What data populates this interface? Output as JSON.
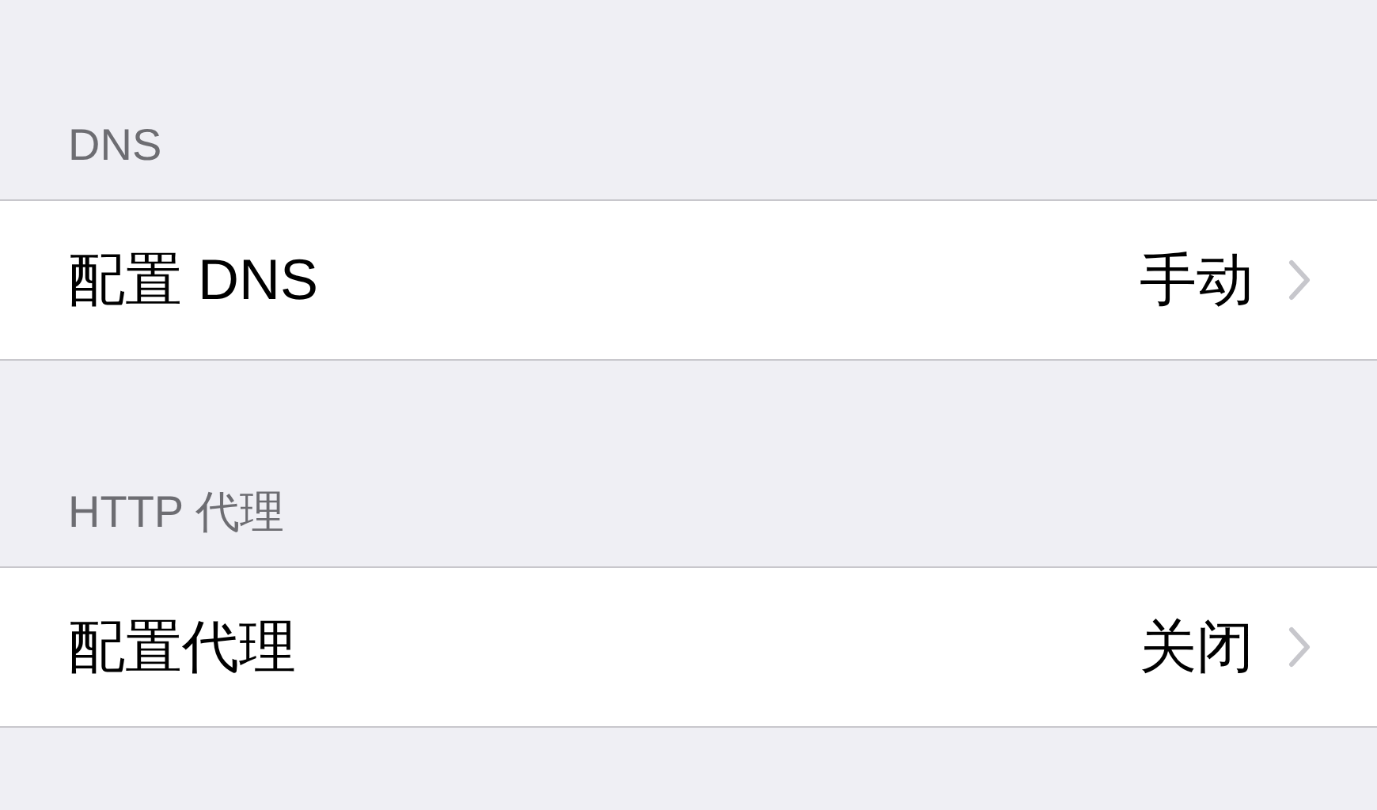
{
  "sections": [
    {
      "header": "DNS",
      "rows": [
        {
          "label": "配置 DNS",
          "value": "手动"
        }
      ]
    },
    {
      "header": "HTTP 代理",
      "rows": [
        {
          "label": "配置代理",
          "value": "关闭"
        }
      ]
    }
  ]
}
